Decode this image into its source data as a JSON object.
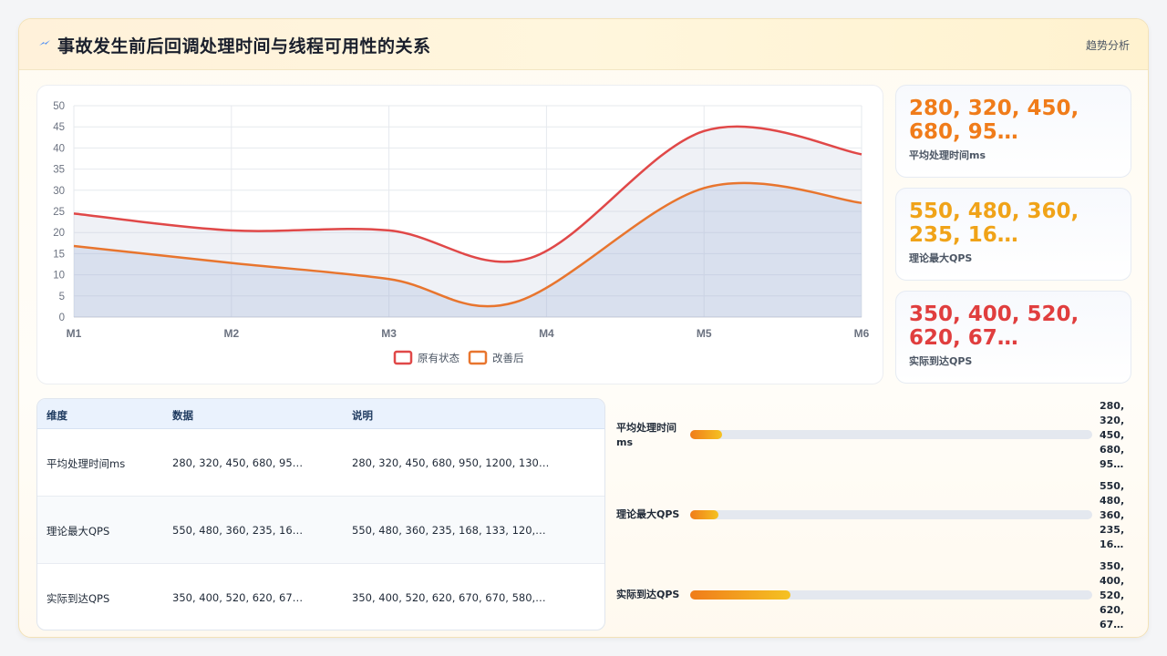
{
  "header": {
    "title": "事故发生前后回调处理时间与线程可用性的关系",
    "right_label": "趋势分析"
  },
  "chart_data": {
    "type": "area",
    "categories": [
      "M1",
      "M2",
      "M3",
      "M4",
      "M5",
      "M6"
    ],
    "x_positions": [
      0,
      1,
      2,
      3,
      4,
      5
    ],
    "ylim": [
      0,
      50
    ],
    "yticks": [
      0,
      5,
      10,
      15,
      20,
      25,
      30,
      35,
      40,
      45,
      50
    ],
    "grid": true,
    "legend_position": "bottom",
    "series": [
      {
        "name": "原有状态",
        "color": "#e04848",
        "points": [
          [
            0,
            24.5
          ],
          [
            1,
            20.5
          ],
          [
            2,
            20.5
          ],
          [
            2.9,
            14
          ],
          [
            4,
            44
          ],
          [
            5,
            38.5
          ]
        ]
      },
      {
        "name": "改善后",
        "color": "#e8752e",
        "points": [
          [
            0,
            16.8
          ],
          [
            1,
            12.8
          ],
          [
            2,
            9
          ],
          [
            2.8,
            3.5
          ],
          [
            4,
            30.5
          ],
          [
            5,
            27
          ]
        ]
      }
    ]
  },
  "stats": [
    {
      "value": "280, 320, 450, 680, 95…",
      "label": "平均处理时间ms",
      "color": "#f07c1a"
    },
    {
      "value": "550, 480, 360, 235, 16…",
      "label": "理论最大QPS",
      "color": "#f0a318"
    },
    {
      "value": "350, 400, 520, 620, 67…",
      "label": "实际到达QPS",
      "color": "#e03e3e"
    }
  ],
  "table": {
    "headers": [
      "维度",
      "数据",
      "说明"
    ],
    "rows": [
      [
        "平均处理时间ms",
        "280, 320, 450, 680, 95…",
        "280, 320, 450, 680, 950, 1200, 130…"
      ],
      [
        "理论最大QPS",
        "550, 480, 360, 235, 16…",
        "550, 480, 360, 235, 168, 133, 120,…"
      ],
      [
        "实际到达QPS",
        "350, 400, 520, 620, 67…",
        "350, 400, 520, 620, 670, 670, 580,…"
      ]
    ]
  },
  "bars": [
    {
      "label": "平均处理时间ms",
      "fraction": 0.08,
      "value": "280, 320, 450, 680, 95…"
    },
    {
      "label": "理论最大QPS",
      "fraction": 0.07,
      "value": "550, 480, 360, 235, 16…"
    },
    {
      "label": "实际到达QPS",
      "fraction": 0.25,
      "value": "350, 400, 520, 620, 67…"
    }
  ]
}
